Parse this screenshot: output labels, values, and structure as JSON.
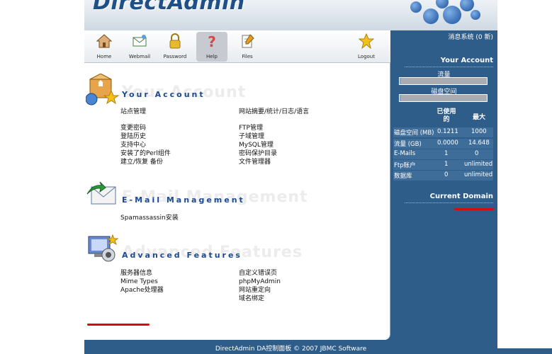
{
  "header": {
    "logo_text": "DirectAdmin"
  },
  "toolbar": {
    "items": [
      {
        "label": "Home",
        "icon": "house-icon"
      },
      {
        "label": "Webmail",
        "icon": "envelope-icon"
      },
      {
        "label": "Password",
        "icon": "padlock-icon"
      },
      {
        "label": "Help",
        "icon": "question-icon"
      },
      {
        "label": "Files",
        "icon": "files-icon"
      },
      {
        "label": "Logout",
        "icon": "star-icon"
      }
    ]
  },
  "sections": {
    "account": {
      "title": "Your Account",
      "ghost": "Your Account",
      "left": [
        "站点管理",
        "变更密码",
        "登陆历史",
        "支持中心",
        "安装了的Perl组件",
        "建立/恢复 备份"
      ],
      "right": [
        "网站摘要/统计/日志/语言",
        "FTP管理",
        "子域管理",
        "MySQL管理",
        "密码保护目录",
        "文件管理器"
      ]
    },
    "email": {
      "title": "E-Mail Management",
      "ghost": "E-Mail Management",
      "left": [
        "Spamassassin安装"
      ]
    },
    "advanced": {
      "title": "Advanced Features",
      "ghost": "Advanced Features",
      "left": [
        "服务器信息",
        "Mime Types",
        "Apache处理器"
      ],
      "right": [
        "自定义错误页",
        "phpMyAdmin",
        "网站重定向",
        "域名绑定"
      ]
    }
  },
  "sidebar": {
    "messages": "消息系统 (0 新)",
    "your_account": "Your Account",
    "bandwidth_label": "流量",
    "disk_label": "磁盘空间",
    "bandwidth_fill": 0.01,
    "disk_fill": 0.01,
    "col_used": "已使用的",
    "col_max": "最大",
    "rows": [
      {
        "name": "磁盘空间 (MB)",
        "used": "0.1211",
        "max": "1000"
      },
      {
        "name": "流量 (GB)",
        "used": "0.0000",
        "max": "14.648"
      },
      {
        "name": "E-Mails",
        "used": "1",
        "max": "0"
      },
      {
        "name": "Ftp账户",
        "used": "1",
        "max": "unlimited"
      },
      {
        "name": "数据库",
        "used": "0",
        "max": "unlimited"
      }
    ],
    "current_domain": "Current Domain"
  },
  "footer": {
    "text": "DirectAdmin DA控制面板 © 2007 JBMC Software"
  },
  "colors": {
    "frame": "#2f5d89",
    "title_blue": "#1b4a93",
    "redaction": "#d01010"
  }
}
